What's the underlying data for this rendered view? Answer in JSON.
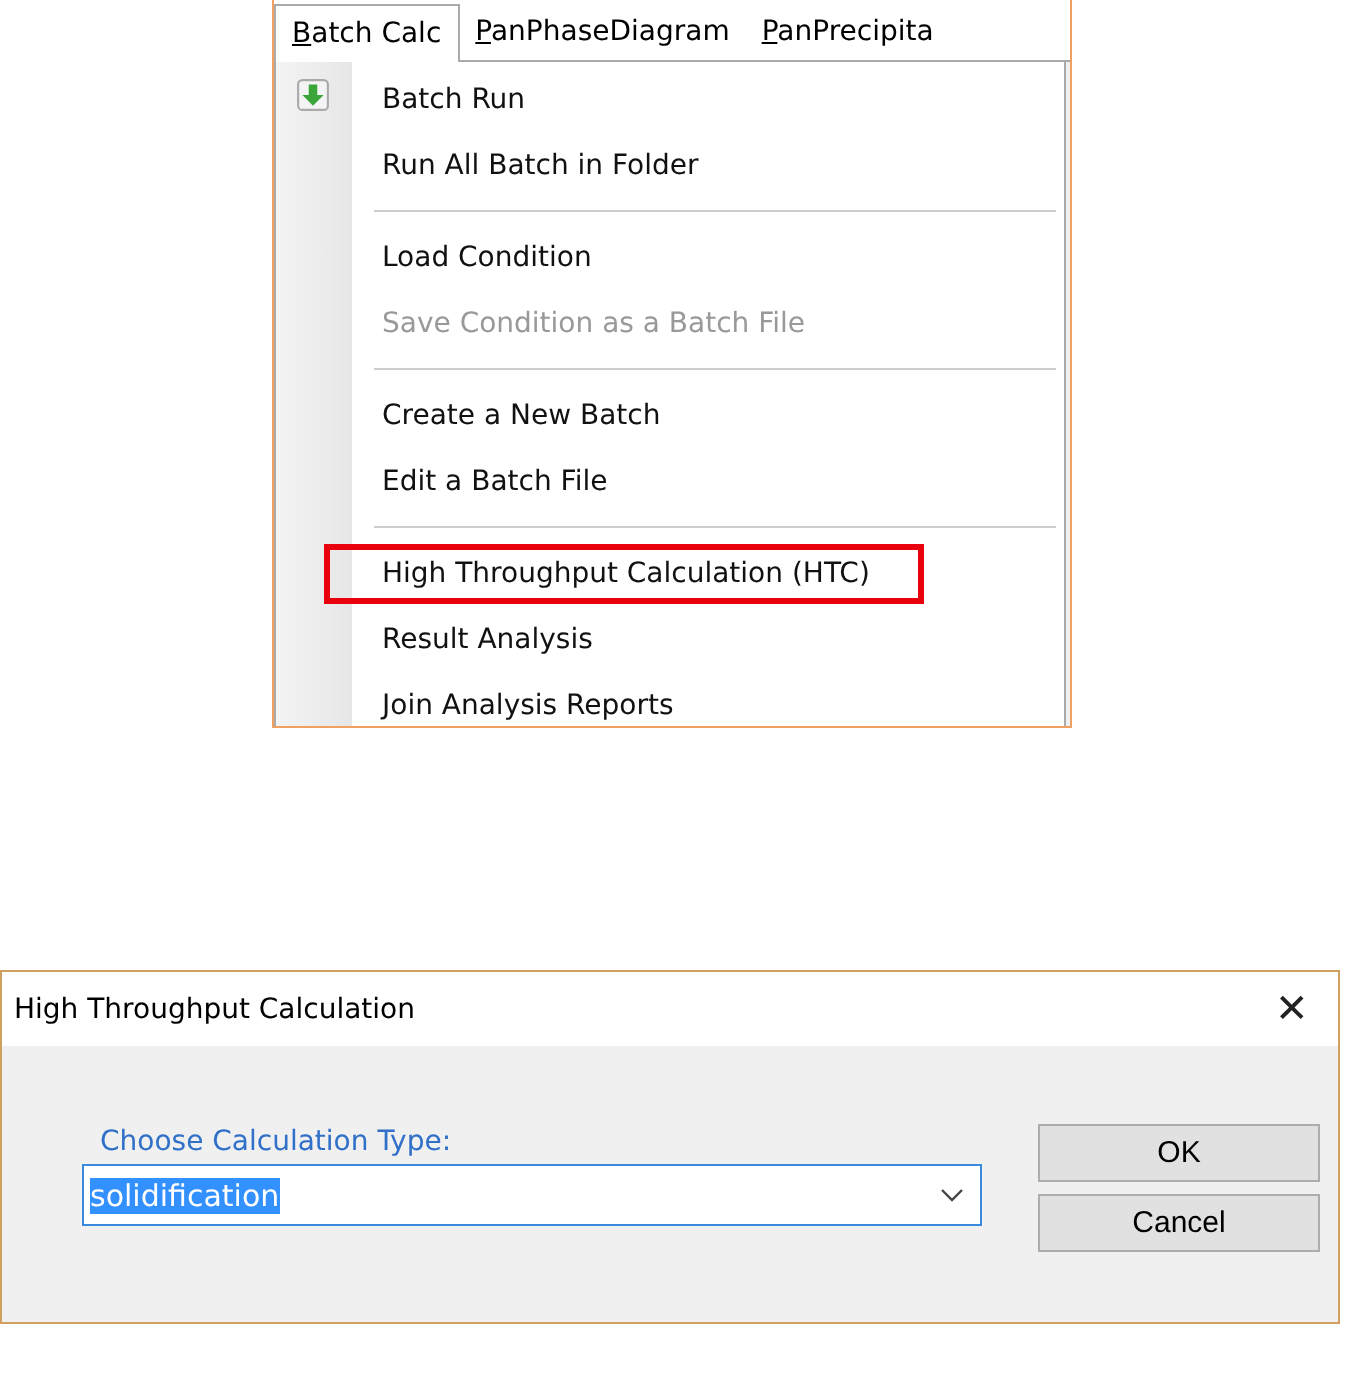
{
  "menu_bar": {
    "tabs": [
      {
        "label": "Batch Calc",
        "selected": true,
        "mnemonic": true
      },
      {
        "label": "PanPhaseDiagram",
        "selected": false,
        "mnemonic": true
      },
      {
        "label": "PanPrecipita",
        "selected": false,
        "mnemonic": true
      }
    ]
  },
  "menu": {
    "items": [
      {
        "kind": "item",
        "label": "Batch Run",
        "icon": true,
        "disabled": false,
        "highlighted": false
      },
      {
        "kind": "item",
        "label": "Run All Batch in Folder",
        "icon": false,
        "disabled": false,
        "highlighted": false
      },
      {
        "kind": "separator"
      },
      {
        "kind": "item",
        "label": "Load Condition",
        "icon": false,
        "disabled": false,
        "highlighted": false
      },
      {
        "kind": "item",
        "label": "Save Condition as a Batch File",
        "icon": false,
        "disabled": true,
        "highlighted": false
      },
      {
        "kind": "separator"
      },
      {
        "kind": "item",
        "label": "Create a New Batch",
        "icon": false,
        "disabled": false,
        "highlighted": false
      },
      {
        "kind": "item",
        "label": "Edit a Batch File",
        "icon": false,
        "disabled": false,
        "highlighted": false
      },
      {
        "kind": "separator"
      },
      {
        "kind": "item",
        "label": "High Throughput Calculation (HTC)",
        "icon": false,
        "disabled": false,
        "highlighted": true
      },
      {
        "kind": "item",
        "label": "Result Analysis",
        "icon": false,
        "disabled": false,
        "highlighted": false
      },
      {
        "kind": "item",
        "label": "Join Analysis Reports",
        "icon": false,
        "disabled": false,
        "highlighted": false
      }
    ]
  },
  "dialog": {
    "title": "High Throughput Calculation",
    "close": "✕",
    "field_label": "Choose Calculation Type:",
    "combo": {
      "value": "solidification",
      "selected_text": true
    },
    "buttons": [
      "OK",
      "Cancel"
    ]
  }
}
